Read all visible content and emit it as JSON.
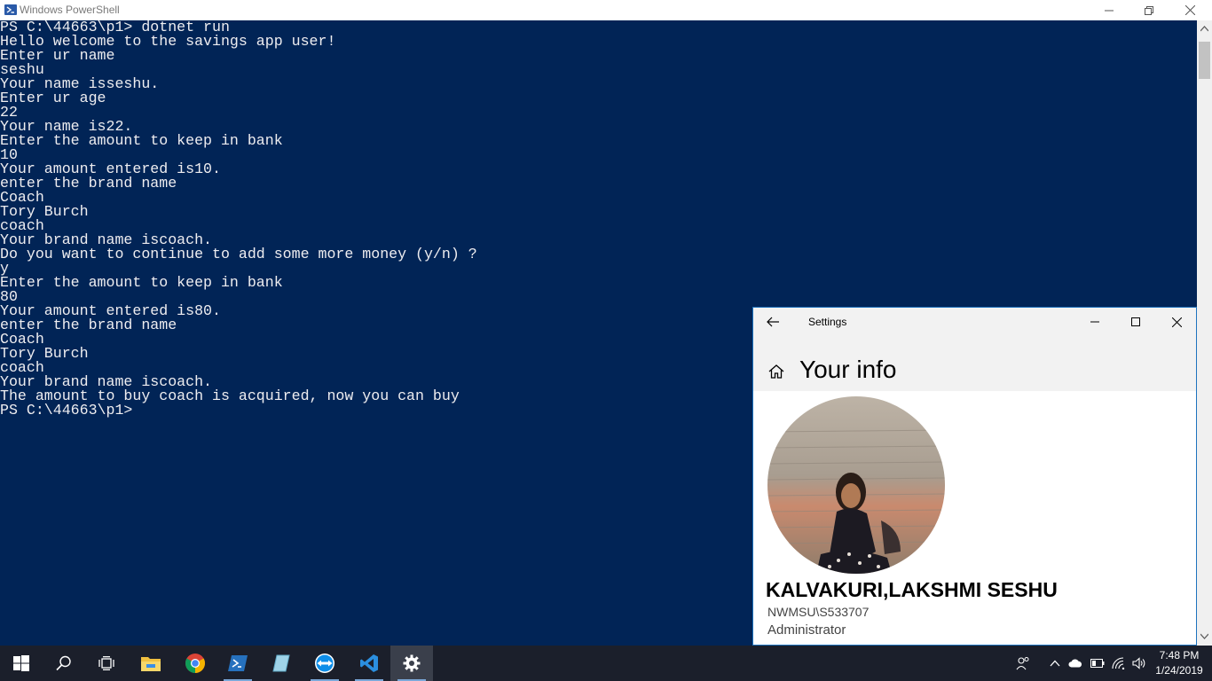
{
  "powershell": {
    "title": "Windows PowerShell",
    "lines": [
      "PS C:\\44663\\p1> dotnet run",
      "Hello welcome to the savings app user!",
      "Enter ur name",
      "seshu",
      "Your name isseshu.",
      "Enter ur age",
      "22",
      "Your name is22.",
      "Enter the amount to keep in bank",
      "10",
      "Your amount entered is10.",
      "enter the brand name",
      "Coach",
      "Tory Burch",
      "coach",
      "Your brand name iscoach.",
      "Do you want to continue to add some more money (y/n) ?",
      "y",
      "Enter the amount to keep in bank",
      "80",
      "Your amount entered is80.",
      "enter the brand name",
      "Coach",
      "Tory Burch",
      "coach",
      "Your brand name iscoach.",
      "The amount to buy coach is acquired, now you can buy",
      "PS C:\\44663\\p1>"
    ],
    "colors": {
      "background": "#012456",
      "text": "#eeedf0"
    }
  },
  "settings": {
    "title": "Settings",
    "heading": "Your info",
    "user_name": "KALVAKURI,LAKSHMI SESHU",
    "account": "NWMSU\\S533707",
    "role": "Administrator"
  },
  "taskbar": {
    "apps": [
      "start-icon",
      "search-icon",
      "task-view-icon",
      "file-explorer-icon",
      "chrome-icon",
      "powershell-icon",
      "notepad-icon",
      "teamviewer-icon",
      "vscode-icon",
      "settings-gear-icon"
    ],
    "clock": {
      "time": "7:48 PM",
      "date": "1/24/2019"
    }
  }
}
